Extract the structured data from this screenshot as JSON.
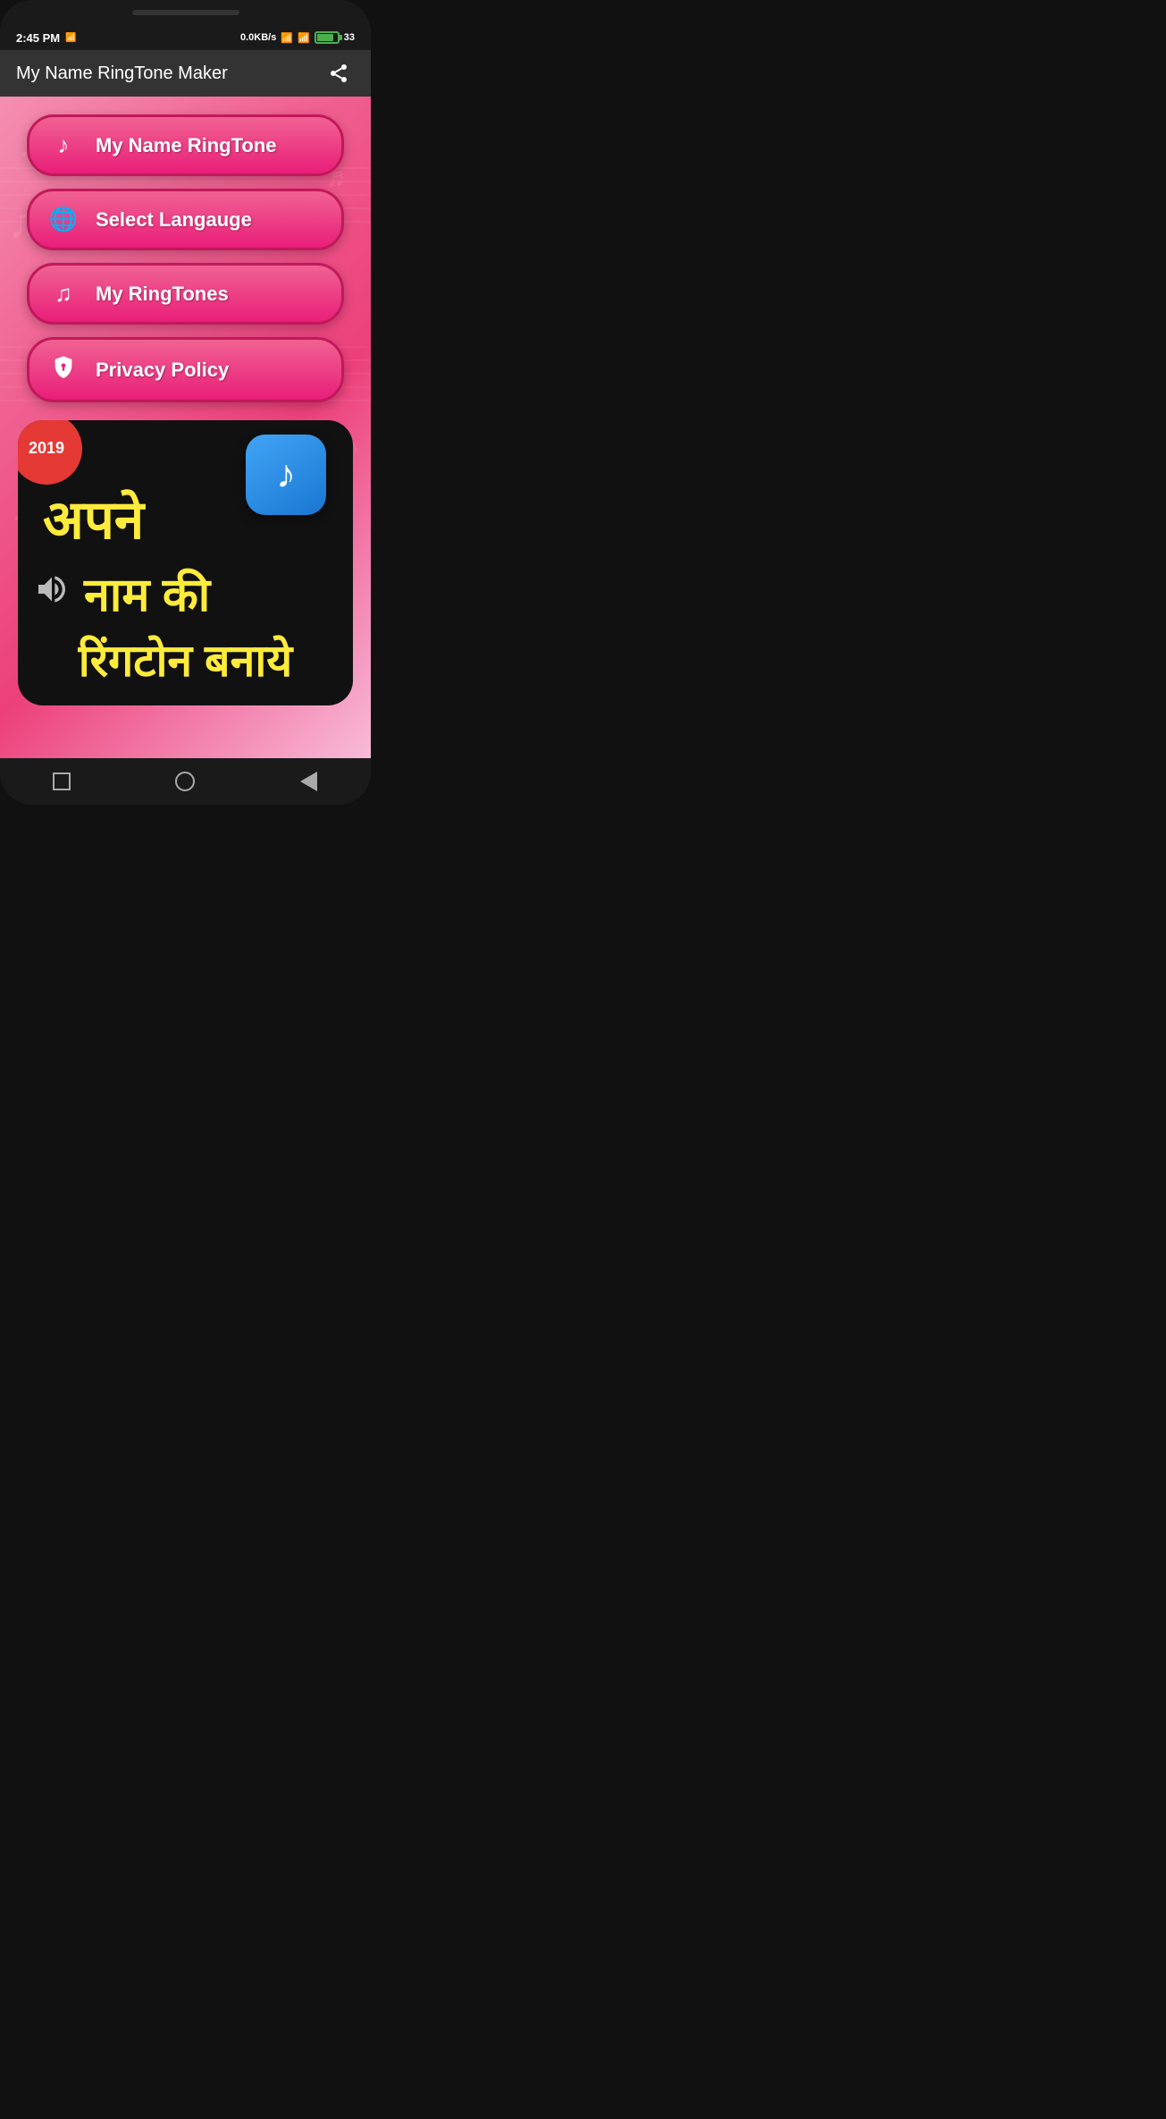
{
  "statusBar": {
    "time": "2:45 PM",
    "network": "0.0KB/s",
    "battery": "33"
  },
  "appBar": {
    "title": "My Name RingTone Maker",
    "shareLabel": "share"
  },
  "menu": {
    "buttons": [
      {
        "id": "my-name-ringtone",
        "label": "My Name RingTone",
        "icon": "♪"
      },
      {
        "id": "select-language",
        "label": "Select Langauge",
        "icon": "🌐"
      },
      {
        "id": "my-ringtones",
        "label": "My RingTones",
        "icon": "♫"
      },
      {
        "id": "privacy-policy",
        "label": "Privacy Policy",
        "icon": "🛡"
      }
    ]
  },
  "banner": {
    "year": "2019",
    "hindiLine1": "अपने",
    "hindiLine2": "नाम की",
    "hindiLine3": "रिंगटोन बनाये"
  },
  "navBar": {
    "stop": "stop",
    "home": "home",
    "back": "back"
  }
}
